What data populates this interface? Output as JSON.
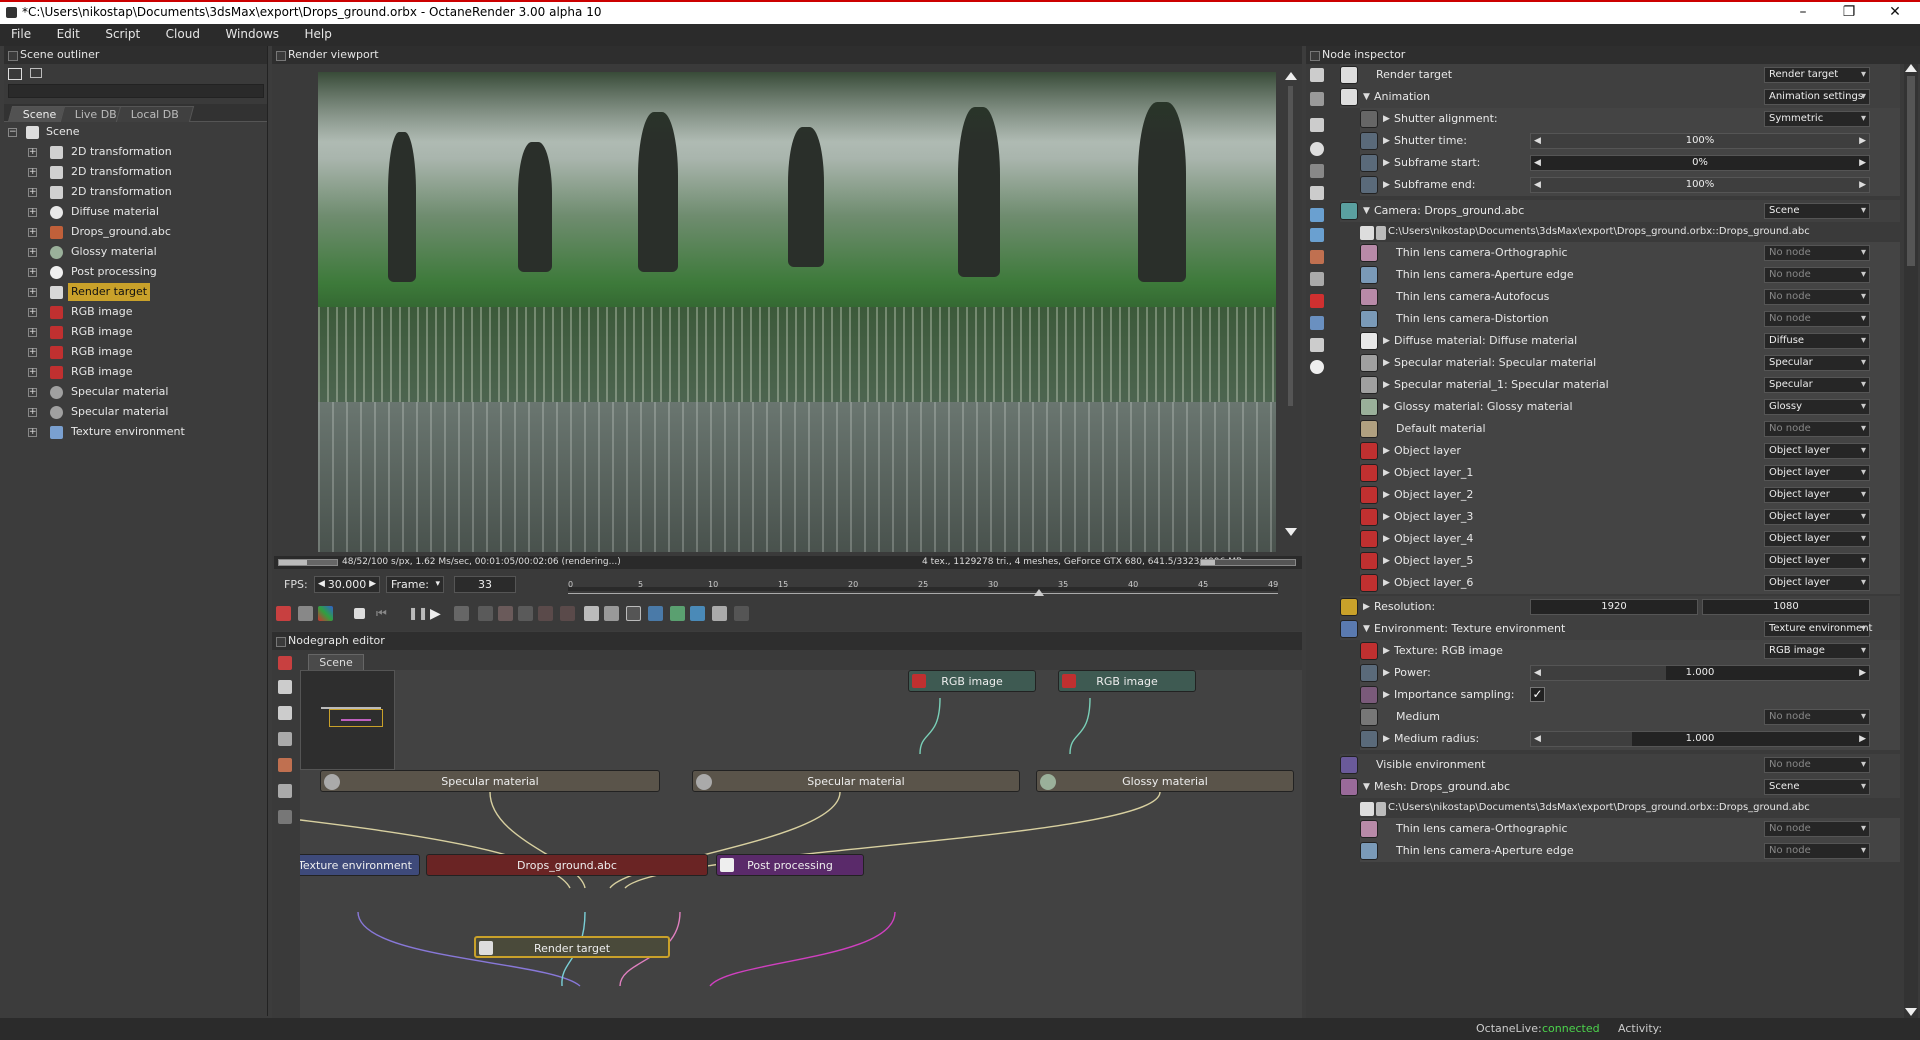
{
  "window": {
    "title": "*C:\\Users\\nikostap\\Documents\\3dsMax\\export\\Drops_ground.orbx - OctaneRender 3.00 alpha 10",
    "minimize": "–",
    "maximize": "❐",
    "close": "✕"
  },
  "menu": [
    "File",
    "Edit",
    "Script",
    "Cloud",
    "Windows",
    "Help"
  ],
  "outliner": {
    "title": "Scene outliner",
    "tabs": [
      "Scene",
      "Live DB",
      "Local DB"
    ],
    "root": "Scene",
    "items": [
      {
        "label": "2D transformation",
        "icon": "transform-icon",
        "color": "#d0d0d0"
      },
      {
        "label": "2D transformation",
        "icon": "transform-icon",
        "color": "#d0d0d0"
      },
      {
        "label": "2D transformation",
        "icon": "transform-icon",
        "color": "#d0d0d0"
      },
      {
        "label": "Diffuse material",
        "icon": "sphere-icon",
        "color": "#e8e8e8"
      },
      {
        "label": "Drops_ground.abc",
        "icon": "mesh-icon",
        "color": "#c0603a"
      },
      {
        "label": "Glossy material",
        "icon": "sphere-icon",
        "color": "#9ab09a"
      },
      {
        "label": "Post processing",
        "icon": "sun-icon",
        "color": "#f0f0f0"
      },
      {
        "label": "Render target",
        "icon": "render-target-icon",
        "color": "#d8d8d8",
        "selected": true
      },
      {
        "label": "RGB image",
        "icon": "image-icon",
        "color": "#c03030"
      },
      {
        "label": "RGB image",
        "icon": "image-icon",
        "color": "#c03030"
      },
      {
        "label": "RGB image",
        "icon": "image-icon",
        "color": "#c03030"
      },
      {
        "label": "RGB image",
        "icon": "image-icon",
        "color": "#c03030"
      },
      {
        "label": "Specular material",
        "icon": "sphere-icon",
        "color": "#a0a0a0"
      },
      {
        "label": "Specular material",
        "icon": "sphere-icon",
        "color": "#a0a0a0"
      },
      {
        "label": "Texture environment",
        "icon": "environment-icon",
        "color": "#7aa0d0"
      }
    ]
  },
  "viewport": {
    "title": "Render viewport",
    "status_left": "48/52/100 s/px, 1.62 Ms/sec, 00:01:05/00:02:06 (rendering...)",
    "status_right": "4 tex., 1129278 tri., 4 meshes, GeForce GTX 680, 641.5/3323/4096 MB",
    "progress": 0.48,
    "fps_label": "FPS:",
    "fps_value": "30.000",
    "frame_label": "Frame:",
    "frame_value": "33",
    "timeline_ticks": [
      "0",
      "5",
      "10",
      "15",
      "20",
      "25",
      "30",
      "35",
      "40",
      "45",
      "49"
    ]
  },
  "nodegraph": {
    "title": "Nodegraph editor",
    "tab": "Scene",
    "nodes": {
      "rgb1": "RGB image",
      "rgb2": "RGB image",
      "spec1": "Specular material",
      "spec2": "Specular material",
      "glossy": "Glossy material",
      "texenv": "Texture environment",
      "mesh": "Drops_ground.abc",
      "post": "Post processing",
      "rt": "Render target"
    }
  },
  "inspector": {
    "title": "Node inspector",
    "header_label": "Render target",
    "header_drop": "Render target",
    "rows": {
      "animation": {
        "label": "Animation",
        "drop": "Animation settings"
      },
      "shutter_align": {
        "label": "Shutter alignment:",
        "drop": "Symmetric"
      },
      "shutter_time": {
        "label": "Shutter time:",
        "value": "100%",
        "fill": 1.0
      },
      "sub_start": {
        "label": "Subframe start:",
        "value": "0%",
        "fill": 0.0
      },
      "sub_end": {
        "label": "Subframe end:",
        "value": "100%",
        "fill": 1.0
      },
      "camera": {
        "label": "Camera: Drops_ground.abc",
        "drop": "Scene"
      },
      "camera_path": "C:\\Users\\nikostap\\Documents\\3dsMax\\export\\Drops_ground.orbx::Drops_ground.abc",
      "cam_items": [
        {
          "label": "Thin lens camera-Orthographic",
          "drop": "No node",
          "color": "#b88aa8"
        },
        {
          "label": "Thin lens camera-Aperture edge",
          "drop": "No node",
          "color": "#7a9ab8"
        },
        {
          "label": "Thin lens camera-Autofocus",
          "drop": "No node",
          "color": "#b88aa8"
        },
        {
          "label": "Thin lens camera-Distortion",
          "drop": "No node",
          "color": "#7a9ab8"
        },
        {
          "label": "Diffuse material: Diffuse material",
          "drop": "Diffuse",
          "color": "#e8e8e8",
          "arrow": true
        },
        {
          "label": "Specular material: Specular material",
          "drop": "Specular",
          "color": "#a0a0a0",
          "arrow": true
        },
        {
          "label": "Specular material_1: Specular material",
          "drop": "Specular",
          "color": "#a0a0a0",
          "arrow": true
        },
        {
          "label": "Glossy material: Glossy material",
          "drop": "Glossy",
          "color": "#9ab09a",
          "arrow": true
        },
        {
          "label": "Default material",
          "drop": "No node",
          "color": "#b0a080"
        },
        {
          "label": "Object layer",
          "drop": "Object layer",
          "color": "#c03030",
          "arrow": true
        },
        {
          "label": "Object layer_1",
          "drop": "Object layer",
          "color": "#c03030",
          "arrow": true
        },
        {
          "label": "Object layer_2",
          "drop": "Object layer",
          "color": "#c03030",
          "arrow": true
        },
        {
          "label": "Object layer_3",
          "drop": "Object layer",
          "color": "#c03030",
          "arrow": true
        },
        {
          "label": "Object layer_4",
          "drop": "Object layer",
          "color": "#c03030",
          "arrow": true
        },
        {
          "label": "Object layer_5",
          "drop": "Object layer",
          "color": "#c03030",
          "arrow": true
        },
        {
          "label": "Object layer_6",
          "drop": "Object layer",
          "color": "#c03030",
          "arrow": true
        }
      ],
      "resolution": {
        "label": "Resolution:",
        "w": "1920",
        "h": "1080"
      },
      "environment": {
        "label": "Environment: Texture environment",
        "drop": "Texture environment"
      },
      "texture": {
        "label": "Texture: RGB image",
        "drop": "RGB image"
      },
      "power": {
        "label": "Power:",
        "value": "1.000",
        "fill": 0.4
      },
      "importance": {
        "label": "Importance sampling:",
        "check": "✓"
      },
      "medium": {
        "label": "Medium",
        "drop": "No node"
      },
      "medium_radius": {
        "label": "Medium radius:",
        "value": "1.000",
        "fill": 0.3
      },
      "visible_env": {
        "label": "Visible environment",
        "drop": "No node"
      },
      "mesh": {
        "label": "Mesh: Drops_ground.abc",
        "drop": "Scene"
      },
      "mesh_path": "C:\\Users\\nikostap\\Documents\\3dsMax\\export\\Drops_ground.orbx::Drops_ground.abc",
      "mesh_items": [
        {
          "label": "Thin lens camera-Orthographic",
          "drop": "No node"
        },
        {
          "label": "Thin lens camera-Aperture edge",
          "drop": "No node"
        }
      ]
    }
  },
  "statusbar": {
    "live_label": "OctaneLive:",
    "live_value": "connected",
    "activity_label": "Activity:"
  },
  "colors": {
    "accent": "#c9a12a",
    "connected": "#4cd44c"
  }
}
